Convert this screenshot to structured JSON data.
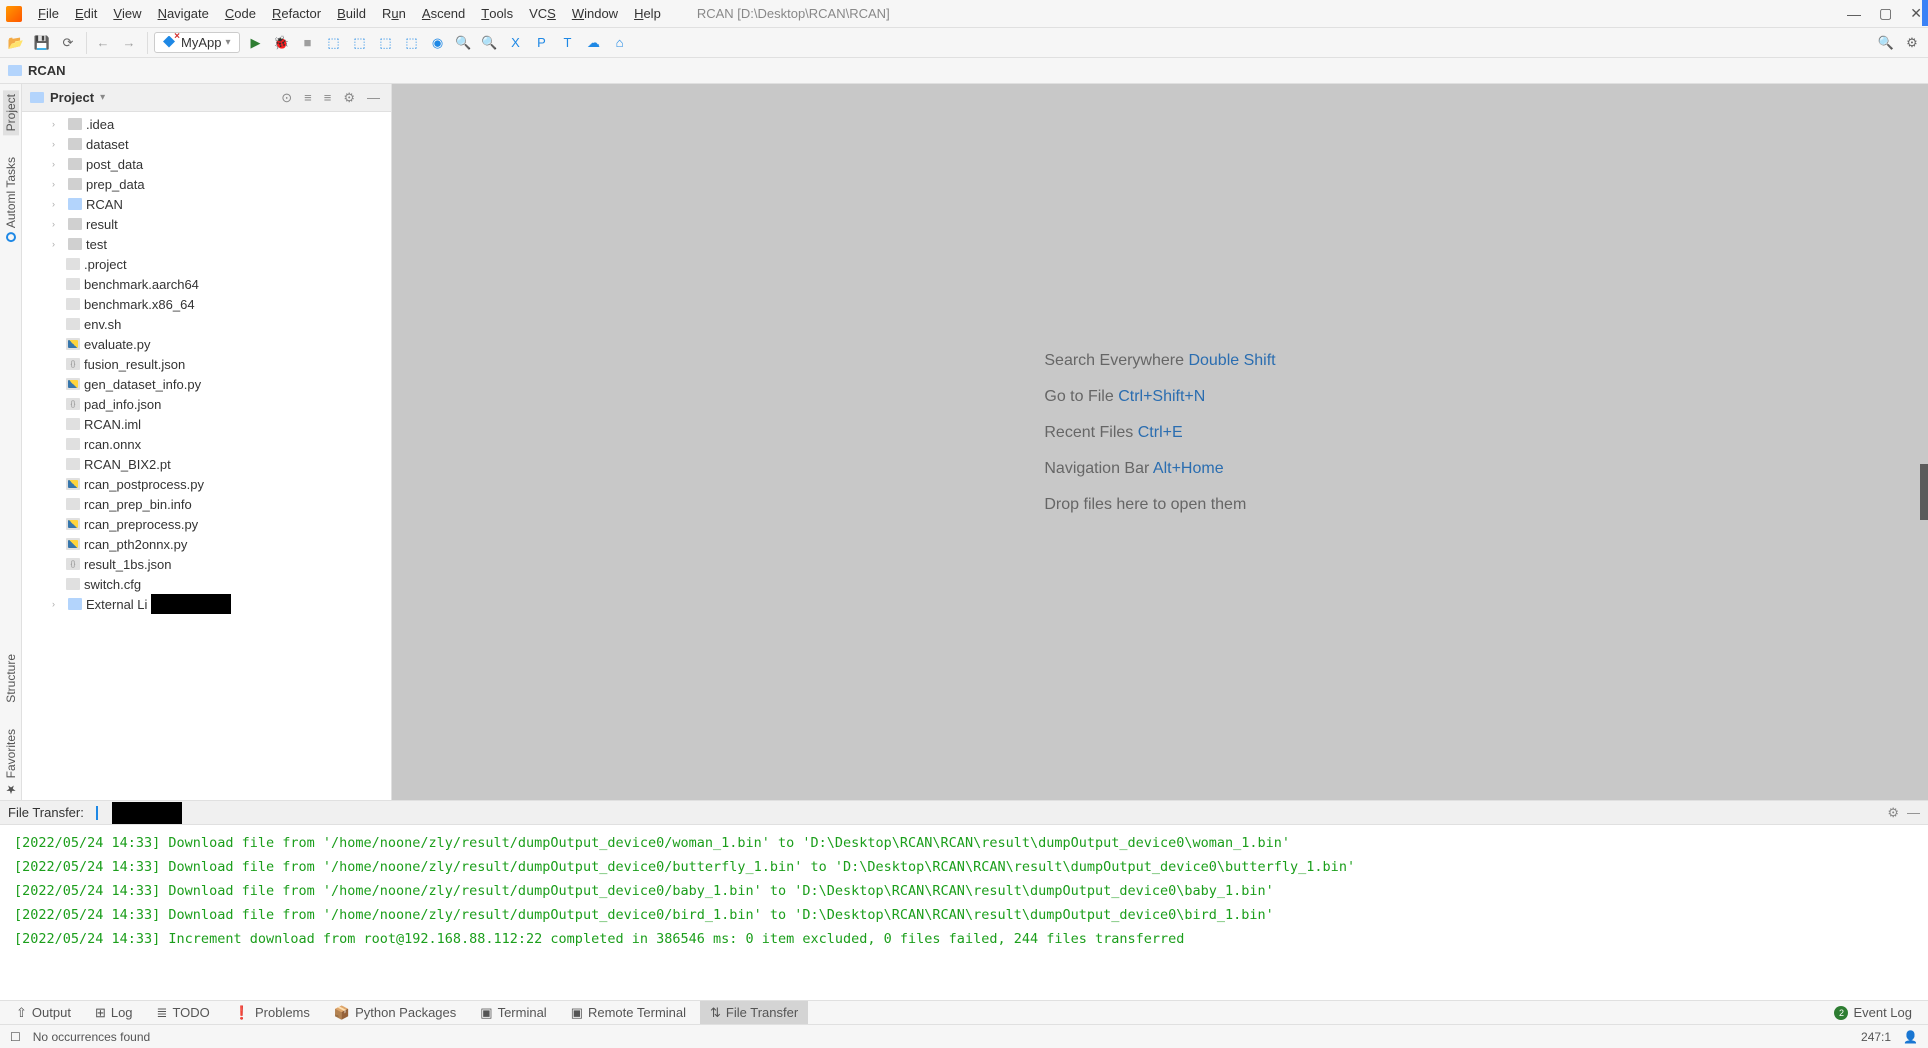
{
  "window": {
    "title_path": "RCAN [D:\\Desktop\\RCAN\\RCAN]"
  },
  "menu": [
    "File",
    "Edit",
    "View",
    "Navigate",
    "Code",
    "Refactor",
    "Build",
    "Run",
    "Ascend",
    "Tools",
    "VCS",
    "Window",
    "Help"
  ],
  "runconfig": {
    "name": "MyApp"
  },
  "breadcrumb": {
    "root": "RCAN"
  },
  "project_panel": {
    "title": "Project",
    "folders": [
      ".idea",
      "dataset",
      "post_data",
      "prep_data",
      "RCAN",
      "result",
      "test"
    ],
    "files": [
      {
        "name": ".project",
        "kind": "file"
      },
      {
        "name": "benchmark.aarch64",
        "kind": "file"
      },
      {
        "name": "benchmark.x86_64",
        "kind": "file"
      },
      {
        "name": "env.sh",
        "kind": "file"
      },
      {
        "name": "evaluate.py",
        "kind": "py"
      },
      {
        "name": "fusion_result.json",
        "kind": "json"
      },
      {
        "name": "gen_dataset_info.py",
        "kind": "py"
      },
      {
        "name": "pad_info.json",
        "kind": "json"
      },
      {
        "name": "RCAN.iml",
        "kind": "file"
      },
      {
        "name": "rcan.onnx",
        "kind": "file"
      },
      {
        "name": "RCAN_BIX2.pt",
        "kind": "file"
      },
      {
        "name": "rcan_postprocess.py",
        "kind": "py"
      },
      {
        "name": "rcan_prep_bin.info",
        "kind": "file"
      },
      {
        "name": "rcan_preprocess.py",
        "kind": "py"
      },
      {
        "name": "rcan_pth2onnx.py",
        "kind": "py"
      },
      {
        "name": "result_1bs.json",
        "kind": "json"
      },
      {
        "name": "switch.cfg",
        "kind": "file"
      }
    ],
    "external": "External Li"
  },
  "editor_hints": [
    {
      "label": "Search Everywhere",
      "shortcut": "Double Shift"
    },
    {
      "label": "Go to File",
      "shortcut": "Ctrl+Shift+N"
    },
    {
      "label": "Recent Files",
      "shortcut": "Ctrl+E"
    },
    {
      "label": "Navigation Bar",
      "shortcut": "Alt+Home"
    }
  ],
  "editor_drop_hint": "Drop files here to open them",
  "file_transfer": {
    "title": "File Transfer:",
    "lines": [
      "[2022/05/24 14:33] Download file from '/home/noone/zly/result/dumpOutput_device0/woman_1.bin' to 'D:\\Desktop\\RCAN\\RCAN\\result\\dumpOutput_device0\\woman_1.bin'",
      "[2022/05/24 14:33] Download file from '/home/noone/zly/result/dumpOutput_device0/butterfly_1.bin' to 'D:\\Desktop\\RCAN\\RCAN\\result\\dumpOutput_device0\\butterfly_1.bin'",
      "[2022/05/24 14:33] Download file from '/home/noone/zly/result/dumpOutput_device0/baby_1.bin' to 'D:\\Desktop\\RCAN\\RCAN\\result\\dumpOutput_device0\\baby_1.bin'",
      "[2022/05/24 14:33] Download file from '/home/noone/zly/result/dumpOutput_device0/bird_1.bin' to 'D:\\Desktop\\RCAN\\RCAN\\result\\dumpOutput_device0\\bird_1.bin'",
      "[2022/05/24 14:33] Increment download from root@192.168.88.112:22 completed in 386546 ms: 0 item excluded, 0 files failed, 244 files transferred"
    ]
  },
  "bottom_tabs": [
    "Output",
    "Log",
    "TODO",
    "Problems",
    "Python Packages",
    "Terminal",
    "Remote Terminal",
    "File Transfer"
  ],
  "event_log": {
    "label": "Event Log",
    "count": "2"
  },
  "status": {
    "message": "No occurrences found",
    "cursor": "247:1"
  },
  "left_tabs": {
    "project": "Project",
    "automl": "Automl Tasks",
    "structure": "Structure",
    "favorites": "Favorites"
  }
}
